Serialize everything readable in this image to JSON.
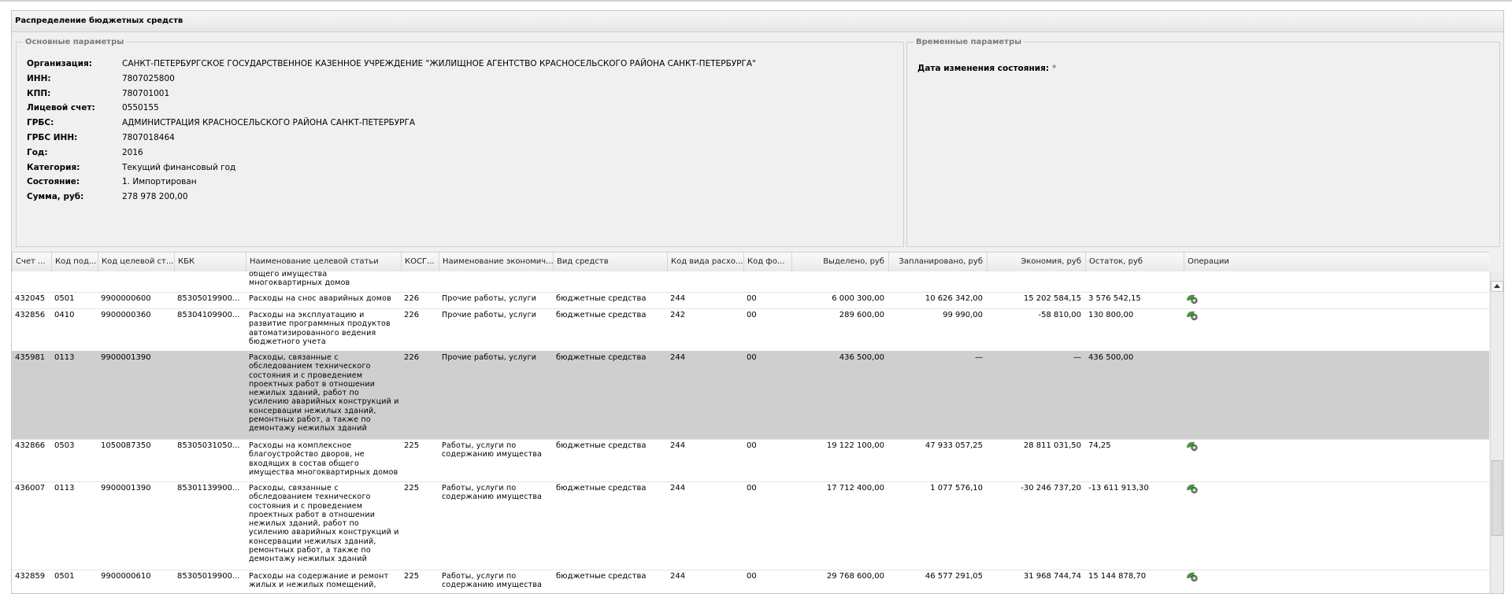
{
  "window": {
    "title": "Распределение бюджетных средств"
  },
  "main_params": {
    "legend": "Основные параметры",
    "fields": [
      {
        "label": "Организация:",
        "value": "САНКТ-ПЕТЕРБУРГСКОЕ ГОСУДАРСТВЕННОЕ КАЗЕННОЕ УЧРЕЖДЕНИЕ \"ЖИЛИЩНОЕ АГЕНТСТВО КРАСНОСЕЛЬСКОГО РАЙОНА САНКТ-ПЕТЕРБУРГА\""
      },
      {
        "label": "ИНН:",
        "value": "7807025800"
      },
      {
        "label": "КПП:",
        "value": "780701001"
      },
      {
        "label": "Лицевой счет:",
        "value": "0550155"
      },
      {
        "label": "ГРБС:",
        "value": "АДМИНИСТРАЦИЯ КРАСНОСЕЛЬСКОГО РАЙОНА САНКТ-ПЕТЕРБУРГА"
      },
      {
        "label": "ГРБС ИНН:",
        "value": "7807018464"
      },
      {
        "label": "Год:",
        "value": "2016"
      },
      {
        "label": "Категория:",
        "value": "Текущий финансовый год"
      },
      {
        "label": "Состояние:",
        "value": "1. Импортирован"
      },
      {
        "label": "Сумма, руб:",
        "value": "278 978 200,00"
      }
    ]
  },
  "time_params": {
    "legend": "Временные параметры",
    "label": "Дата изменения состояния:",
    "required_mark": "*"
  },
  "grid": {
    "columns": [
      {
        "label": "Счет ..."
      },
      {
        "label": "Код под..."
      },
      {
        "label": "Код целевой ст..."
      },
      {
        "label": "КБК"
      },
      {
        "label": "Наименование целевой статьи"
      },
      {
        "label": "КОСГ..."
      },
      {
        "label": "Наименование экономич..."
      },
      {
        "label": "Вид средств"
      },
      {
        "label": "Код вида расхо..."
      },
      {
        "label": "Код фо..."
      },
      {
        "label": "Выделено, руб"
      },
      {
        "label": "Запланировано, руб"
      },
      {
        "label": "Экономия, руб"
      },
      {
        "label": "Остаток, руб"
      },
      {
        "label": "Операции"
      }
    ],
    "rows": [
      {
        "c0": "",
        "c1": "",
        "c2": "",
        "c3": "",
        "c4": "общего имущества многоквартирных домов",
        "c5": "",
        "c6": "",
        "c7": "",
        "c8": "",
        "c9": "",
        "c10": "",
        "c11": "",
        "c12": "",
        "c13": "",
        "op": false
      },
      {
        "c0": "432045",
        "c1": "0501",
        "c2": "9900000600",
        "c3": "85305019900...",
        "c4": "Расходы на снос аварийных домов",
        "c5": "226",
        "c6": "Прочие работы, услуги",
        "c7": "бюджетные средства",
        "c8": "244",
        "c9": "00",
        "c10": "6 000 300,00",
        "c11": "10 626 342,00",
        "c12": "15 202 584,15",
        "c13": "3 576 542,15",
        "op": true
      },
      {
        "c0": "432856",
        "c1": "0410",
        "c2": "9900000360",
        "c3": "85304109900...",
        "c4": "Расходы на эксплуатацию и развитие программных продуктов автоматизированного ведения бюджетного учета",
        "c5": "226",
        "c6": "Прочие работы, услуги",
        "c7": "бюджетные средства",
        "c8": "242",
        "c9": "00",
        "c10": "289 600,00",
        "c11": "99 990,00",
        "c12": "-58 810,00",
        "c13": "130 800,00",
        "op": true
      },
      {
        "c0": "435981",
        "c1": "0113",
        "c2": "9900001390",
        "c3": "",
        "c4": "Расходы, связанные с обследованием технического состояния и с проведением проектных работ в отношении нежилых зданий, работ по усилению аварийных конструкций и консервации нежилых зданий, ремонтных работ, а также по демонтажу нежилых зданий",
        "c5": "226",
        "c6": "Прочие работы, услуги",
        "c7": "бюджетные средства",
        "c8": "244",
        "c9": "00",
        "c10": "436 500,00",
        "c11": "—",
        "c12": "—",
        "c13": "436 500,00",
        "op": false
      },
      {
        "c0": "432866",
        "c1": "0503",
        "c2": "1050087350",
        "c3": "85305031050...",
        "c4": "Расходы на комплексное благоустройство дворов, не входящих в состав общего имущества многоквартирных домов",
        "c5": "225",
        "c6": "Работы, услуги по содержанию имущества",
        "c7": "бюджетные средства",
        "c8": "244",
        "c9": "00",
        "c10": "19 122 100,00",
        "c11": "47 933 057,25",
        "c12": "28 811 031,50",
        "c13": "74,25",
        "op": true
      },
      {
        "c0": "436007",
        "c1": "0113",
        "c2": "9900001390",
        "c3": "85301139900...",
        "c4": "Расходы, связанные с обследованием технического состояния и с проведением проектных работ в отношении нежилых зданий, работ по усилению аварийных конструкций и консервации нежилых зданий, ремонтных работ, а также по демонтажу нежилых зданий",
        "c5": "225",
        "c6": "Работы, услуги по содержанию имущества",
        "c7": "бюджетные средства",
        "c8": "244",
        "c9": "00",
        "c10": "17 712 400,00",
        "c11": "1 077 576,10",
        "c12": "-30 246 737,20",
        "c13": "-13 611 913,30",
        "op": true
      },
      {
        "c0": "432859",
        "c1": "0501",
        "c2": "9900000610",
        "c3": "85305019900...",
        "c4": "Расходы на содержание и ремонт жилых и нежилых помещений,",
        "c5": "225",
        "c6": "Работы, услуги по содержанию имущества",
        "c7": "бюджетные средства",
        "c8": "244",
        "c9": "00",
        "c10": "29 768 600,00",
        "c11": "46 577 291,05",
        "c12": "31 968 744,74",
        "c13": "15 144 878,70",
        "op": true
      }
    ]
  },
  "colors": {
    "selected_row": "#cfcfcf",
    "panel_bg": "#f0f0f0",
    "icon_green": "#3f9c35"
  },
  "icons": {
    "operation": "gear-settings-icon",
    "scroll_up": "scroll-up-arrow-icon"
  }
}
